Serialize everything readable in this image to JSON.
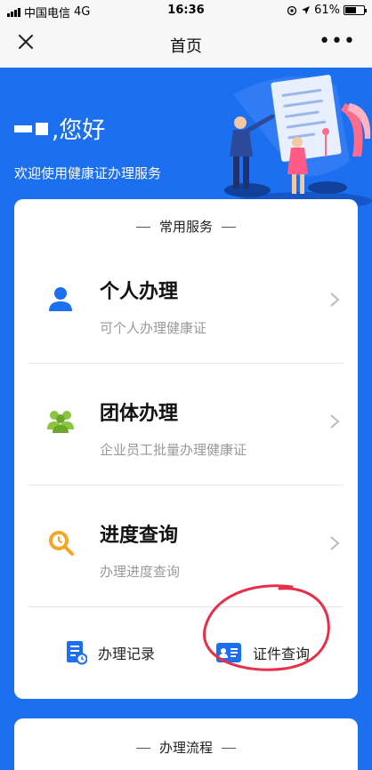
{
  "status_bar": {
    "carrier": "中国电信",
    "network": "4G",
    "time": "16:36",
    "battery": "61%",
    "battery_level": 0.61
  },
  "nav": {
    "title": "首页",
    "more": "•••"
  },
  "hero": {
    "greeting_suffix": ",您好",
    "welcome": "欢迎使用健康证办理服务"
  },
  "services": {
    "header": "常用服务",
    "items": [
      {
        "title": "个人办理",
        "desc": "可个人办理健康证",
        "icon": "person-icon"
      },
      {
        "title": "团体办理",
        "desc": "企业员工批量办理健康证",
        "icon": "group-icon"
      },
      {
        "title": "进度查询",
        "desc": "办理进度查询",
        "icon": "progress-icon"
      }
    ],
    "quick": [
      {
        "label": "办理记录",
        "icon": "record-icon"
      },
      {
        "label": "证件查询",
        "icon": "id-card-icon"
      }
    ]
  },
  "process": {
    "header": "办理流程"
  },
  "colors": {
    "primary": "#1c6fee",
    "green": "#8cc63f",
    "orange": "#f5a623",
    "annotation": "#e6304a"
  }
}
